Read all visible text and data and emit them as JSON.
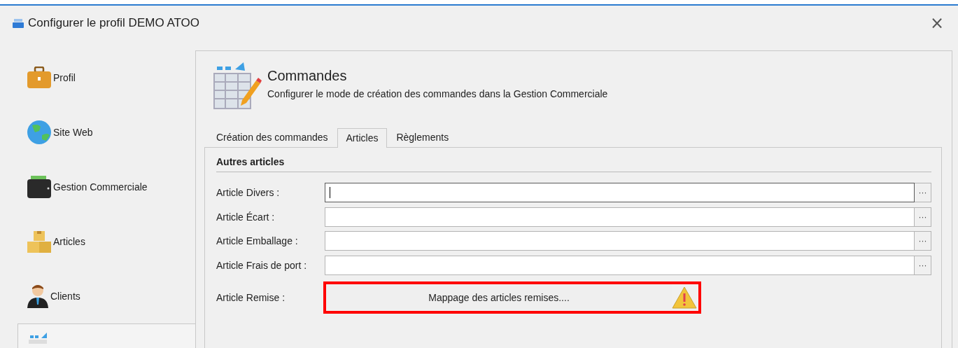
{
  "window": {
    "title": "Configurer le profil DEMO ATOO",
    "close": "×"
  },
  "sidebar": {
    "items": [
      {
        "label": "Profil",
        "selected": false
      },
      {
        "label": "Site Web",
        "selected": false
      },
      {
        "label": "Gestion Commerciale",
        "selected": false
      },
      {
        "label": "Articles",
        "selected": false
      },
      {
        "label": "Clients",
        "selected": false
      },
      {
        "selected": true
      }
    ]
  },
  "header": {
    "title": "Commandes",
    "subtitle": "Configurer le mode de création des commandes dans la Gestion Commerciale"
  },
  "tabs": [
    {
      "label": "Création des commandes",
      "selected": false
    },
    {
      "label": "Articles",
      "selected": true
    },
    {
      "label": "Règlements",
      "selected": false
    }
  ],
  "group": {
    "title": "Autres articles",
    "rows": [
      {
        "kind": "lookup",
        "label": "Article Divers :",
        "focused": true,
        "browse": "···"
      },
      {
        "kind": "lookup",
        "label": "Article Écart :",
        "focused": false,
        "browse": "···"
      },
      {
        "kind": "lookup",
        "label": "Article Emballage :",
        "focused": false,
        "browse": "···"
      },
      {
        "kind": "lookup",
        "label": "Article Frais de port :",
        "focused": false,
        "browse": "···"
      },
      {
        "kind": "action",
        "label": "Article Remise :",
        "button": "Mappage des articles remises....",
        "warning": true,
        "highlighted": true
      }
    ]
  }
}
